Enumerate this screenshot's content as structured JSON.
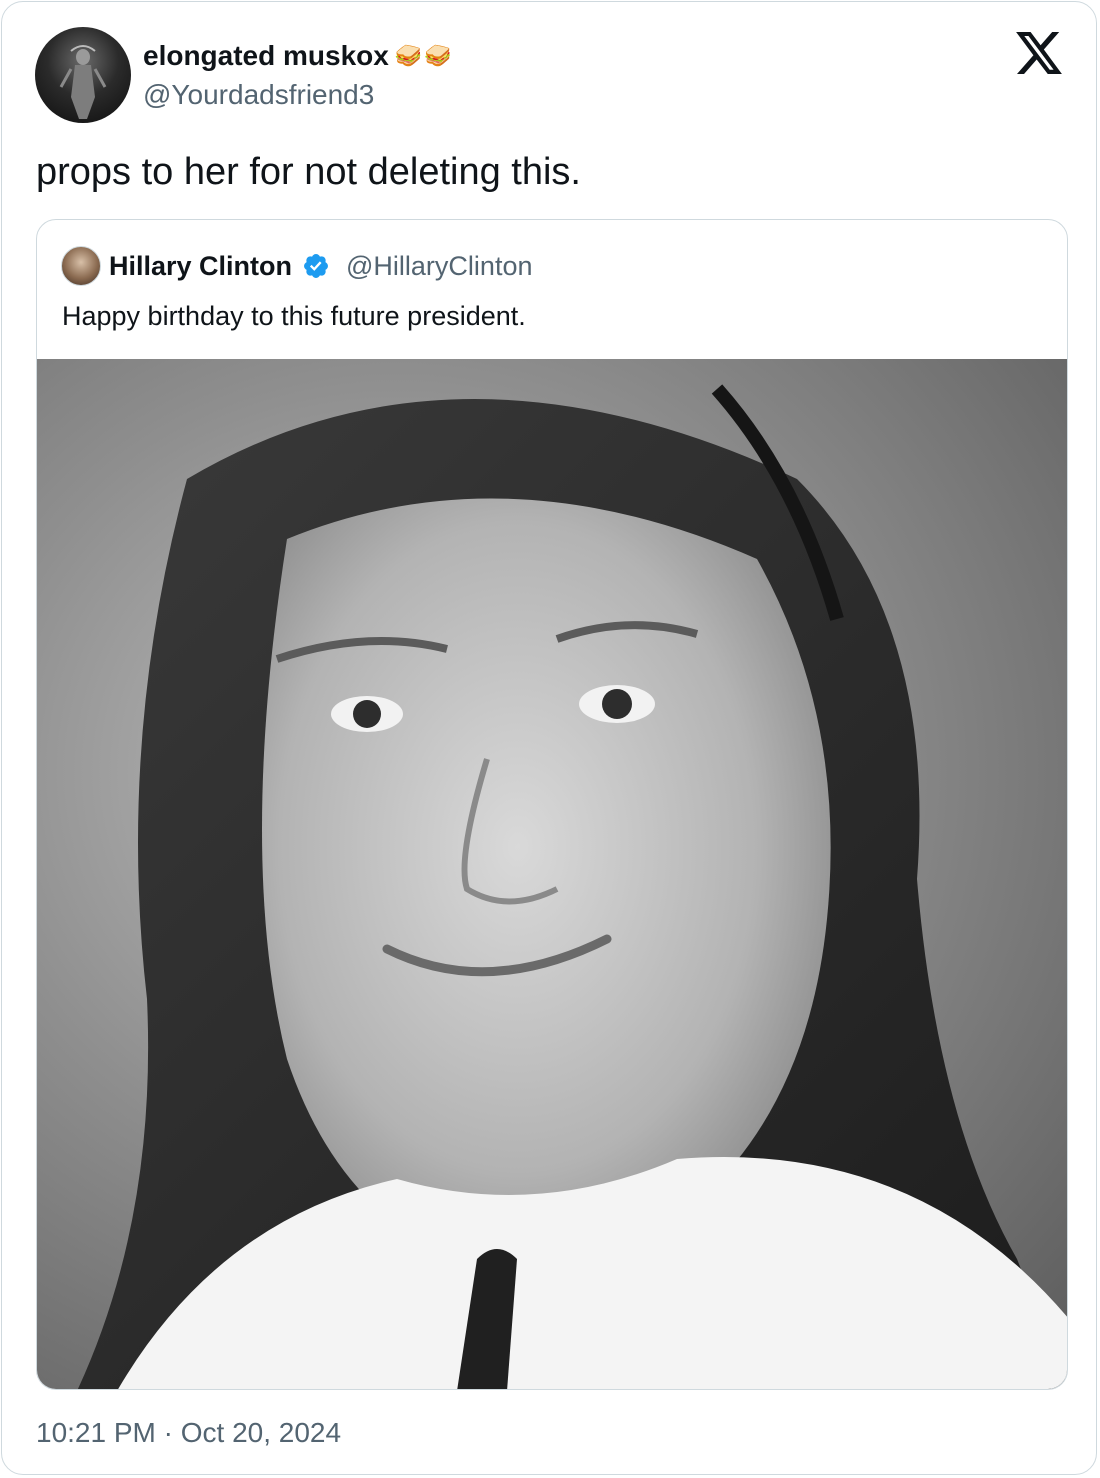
{
  "tweet": {
    "author": {
      "display_name": "elongated muskox",
      "name_emoji_1": "🥪",
      "name_emoji_2": "🥪",
      "handle": "@Yourdadsfriend3"
    },
    "text": "props to her for not deleting this.",
    "timestamp": "10:21 PM · Oct 20, 2024"
  },
  "quoted_tweet": {
    "author": {
      "display_name": "Hillary Clinton",
      "handle": "@HillaryClinton",
      "verified": true
    },
    "text": "Happy birthday to this future president.",
    "media": {
      "type": "photo"
    }
  },
  "icons": {
    "brand": "x-logo-icon",
    "verified": "verified-badge-icon"
  },
  "colors": {
    "text_primary": "#0f1419",
    "text_secondary": "#536471",
    "border": "#cfd9de",
    "verified_blue": "#1d9bf0"
  }
}
